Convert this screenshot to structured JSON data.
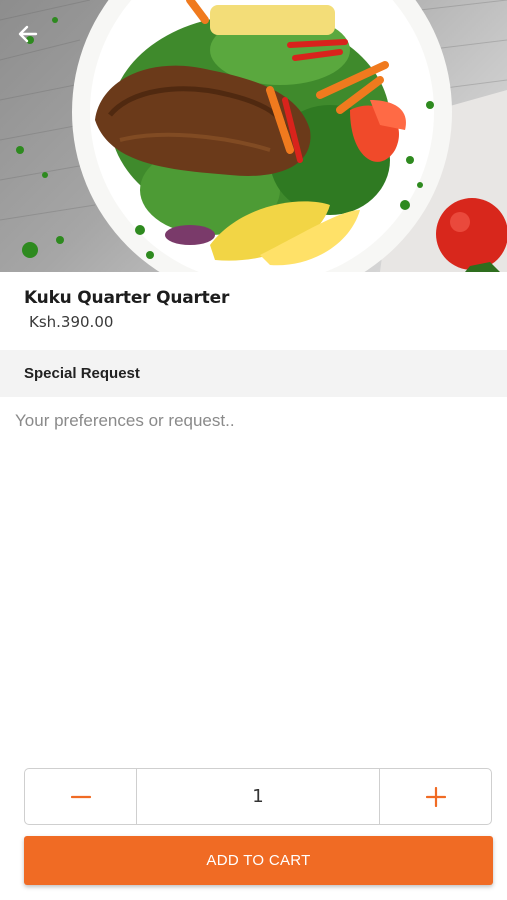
{
  "product": {
    "name": "Kuku Quarter Quarter",
    "price": "Ksh.390.00",
    "image_icon": "dish-photo"
  },
  "nav": {
    "back_icon": "arrow-left-icon"
  },
  "special_request": {
    "title": "Special Request",
    "placeholder": "Your preferences or request..",
    "value": ""
  },
  "quantity": {
    "value": "1",
    "decrement_icon": "minus-icon",
    "increment_icon": "plus-icon"
  },
  "cart": {
    "add_label": "ADD TO CART"
  },
  "colors": {
    "accent": "#f06b24",
    "section_bg": "#f3f3f3",
    "border": "#cfcfcf"
  }
}
